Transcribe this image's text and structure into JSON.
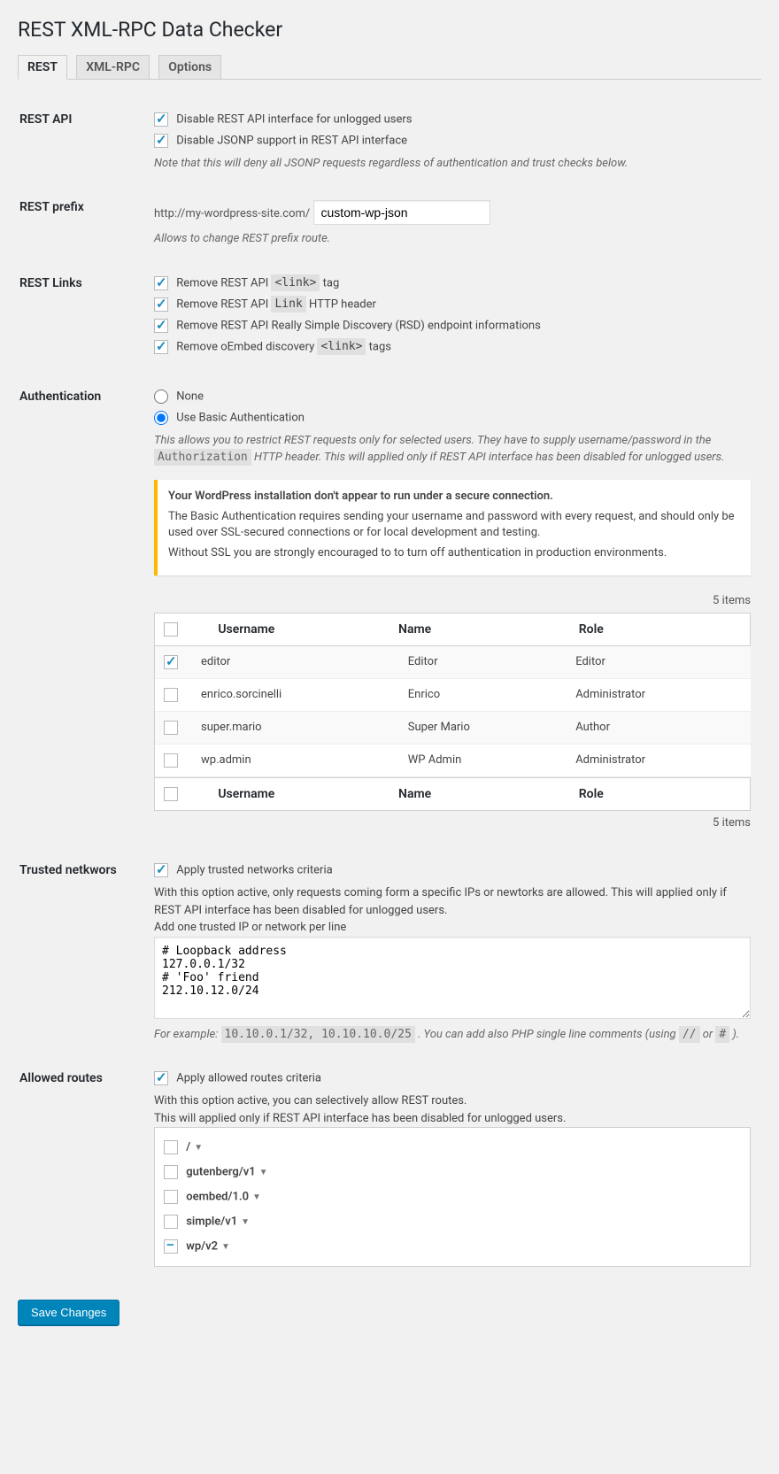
{
  "title": "REST XML-RPC Data Checker",
  "tabs": {
    "rest": "REST",
    "xmlrpc": "XML-RPC",
    "options": "Options"
  },
  "rest_api": {
    "heading": "REST API",
    "disable_unlogged": "Disable REST API interface for unlogged users",
    "disable_jsonp": "Disable JSONP support in REST API interface",
    "jsonp_note": "Note that this will deny all JSONP requests regardless of authentication and trust checks below."
  },
  "rest_prefix": {
    "heading": "REST prefix",
    "base_url": "http://my-wordpress-site.com/",
    "value": "custom-wp-json",
    "help": "Allows to change REST prefix route."
  },
  "rest_links": {
    "heading": "REST Links",
    "l1_pre": "Remove REST API ",
    "l1_code": "<link>",
    "l1_post": " tag",
    "l2_pre": "Remove REST API ",
    "l2_code": "Link",
    "l2_post": " HTTP header",
    "l3": "Remove REST API Really Simple Discovery (RSD) endpoint informations",
    "l4_pre": "Remove oEmbed discovery ",
    "l4_code": "<link>",
    "l4_post": " tags"
  },
  "auth": {
    "heading": "Authentication",
    "none": "None",
    "basic": "Use Basic Authentication",
    "help_pre": "This allows you to restrict REST requests only for selected users. They have to supply username/password in the ",
    "help_code": "Authorization",
    "help_post": " HTTP header. This will applied only if REST API interface has been disabled for unlogged users.",
    "warn_title": "Your WordPress installation don't appear to run under a secure connection.",
    "warn_l1": "The Basic Authentication requires sending your username and password with every request, and should only be used over SSL-secured connections or for local development and testing.",
    "warn_l2": "Without SSL you are strongly encouraged to to turn off authentication in production environments.",
    "items_label": "5 items",
    "cols": {
      "username": "Username",
      "name": "Name",
      "role": "Role"
    },
    "rows": [
      {
        "username": "editor",
        "name": "Editor",
        "role": "Editor",
        "checked": true
      },
      {
        "username": "enrico.sorcinelli",
        "name": "Enrico",
        "role": "Administrator",
        "checked": false
      },
      {
        "username": "super.mario",
        "name": "Super Mario",
        "role": "Author",
        "checked": false
      },
      {
        "username": "wp.admin",
        "name": "WP Admin",
        "role": "Administrator",
        "checked": false
      }
    ]
  },
  "trusted": {
    "heading": "Trusted netkwors",
    "apply": "Apply trusted networks criteria",
    "desc": "With this option active, only requests coming form a specific IPs or newtorks are allowed. This will applied only if REST API interface has been disabled for unlogged users.",
    "hint": "Add one trusted IP or network per line",
    "textarea": "# Loopback address\n127.0.0.1/32\n# 'Foo' friend\n212.10.12.0/24",
    "ex_pre": "For example: ",
    "ex_code": "10.10.0.1/32, 10.10.10.0/25",
    "ex_mid": " . You can add also PHP single line comments (using ",
    "ex_c1": "//",
    "ex_or": " or ",
    "ex_c2": "#",
    "ex_end": " )."
  },
  "routes": {
    "heading": "Allowed routes",
    "apply": "Apply allowed routes criteria",
    "desc1": "With this option active, you can selectively allow REST routes.",
    "desc2": "This will applied only if REST API interface has been disabled for unlogged users.",
    "list": [
      {
        "label": "/",
        "state": "unchecked"
      },
      {
        "label": "gutenberg/v1",
        "state": "unchecked"
      },
      {
        "label": "oembed/1.0",
        "state": "unchecked"
      },
      {
        "label": "simple/v1",
        "state": "unchecked"
      },
      {
        "label": "wp/v2",
        "state": "indeterminate"
      }
    ]
  },
  "save": "Save Changes"
}
